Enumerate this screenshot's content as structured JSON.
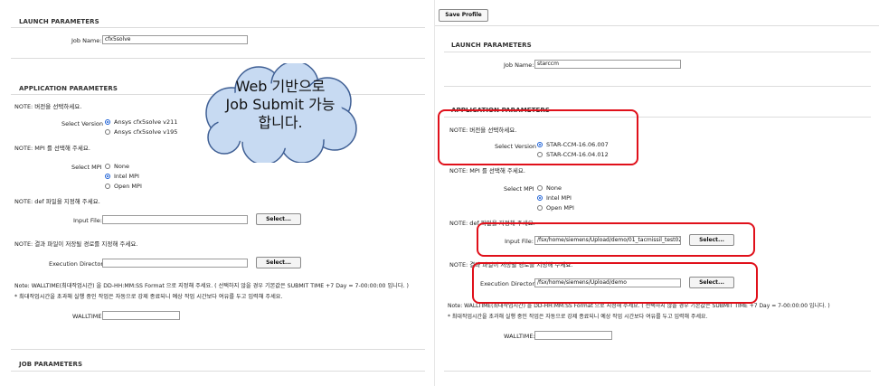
{
  "left": {
    "launch_title": "LAUNCH PARAMETERS",
    "job_name_label": "Job Name:",
    "job_name_value": "cfx5solve",
    "app_title": "APPLICATION PARAMETERS",
    "note_version": "NOTE: 버전을 선택하세요.",
    "select_version_label": "Select Version",
    "versions": [
      "Ansys cfx5solve v211",
      "Ansys cfx5solve v195"
    ],
    "note_mpi": "NOTE: MPI 를 선택해 주세요.",
    "select_mpi_label": "Select MPI",
    "mpis": [
      "None",
      "Intel MPI",
      "Open MPI"
    ],
    "note_def": "NOTE: def 파일을 지정해 주세요.",
    "input_file_label": "Input File:",
    "input_file_value": "",
    "select_button": "Select...",
    "note_result": "NOTE: 결과 파일이 저장될 경로를 지정해 주세요.",
    "exec_dir_label": "Execution Directory:",
    "exec_dir_value": "",
    "walltime_note": "Note:  WALLTIME(최대작업시간) 을  DD-HH:MM:SS Format 으로 지정해 주세요.  ( 선택하지 않을 경우 기본값은 SUBMIT TIME +7 Day = 7-00:00:00 입니다. )",
    "walltime_sub": "* 최대작업시간을 초과해 실행 중인 작업은 자동으로 강제 종료되니 예상 작업 시간보다 여유를 두고 입력해 주세요.",
    "walltime_label": "WALLTIME:",
    "walltime_value": "",
    "job_title": "JOB PARAMETERS"
  },
  "bubble": {
    "line1": "Web 기반으로",
    "line2": "Job Submit 가능",
    "line3": "합니다."
  },
  "right": {
    "save_profile": "Save Profile",
    "launch_title": "LAUNCH PARAMETERS",
    "job_name_label": "Job Name:",
    "job_name_value": "starccm",
    "app_title": "APPLICATION PARAMETERS",
    "note_version": "NOTE: 버전을 선택하세요.",
    "select_version_label": "Select Version",
    "versions": [
      "STAR-CCM-16.06.007",
      "STAR-CCM-16.04.012"
    ],
    "note_mpi": "NOTE: MPI 를 선택해 주세요.",
    "select_mpi_label": "Select MPI",
    "mpis": [
      "None",
      "Intel MPI",
      "Open MPI"
    ],
    "note_def": "NOTE: def 파일을 지정해 주세요.",
    "input_file_label": "Input File:",
    "input_file_value": "/fsx/home/siemens/Upload/demo/01_tacmissil_test02",
    "select_button": "Select...",
    "note_result": "NOTE: 결과 파일이 저장될 경로를 지정해 주세요.",
    "exec_dir_label": "Execution Directory:",
    "exec_dir_value": "/fsx/home/siemens/Upload/demo",
    "walltime_note": "Note:  WALLTIME(최대작업시간) 을  DD-HH:MM:SS Format 으로 지정해 주세요.  ( 선택하지 않을 경우 기본값은 SUBMIT TIME +7 Day = 7-00:00:00 입니다. )",
    "walltime_sub": "* 최대작업시간을 초과해 실행 중인 작업은 자동으로 강제 종료되니 예상 작업 시간보다 여유를 두고 입력해 주세요.",
    "walltime_label": "WALLTIME:",
    "walltime_value": ""
  },
  "colors": {
    "highlight": "#e0101a",
    "bubble_fill": "#c7daf2",
    "bubble_stroke": "#3f5f94",
    "radio_selected": "#1a5fd6"
  }
}
